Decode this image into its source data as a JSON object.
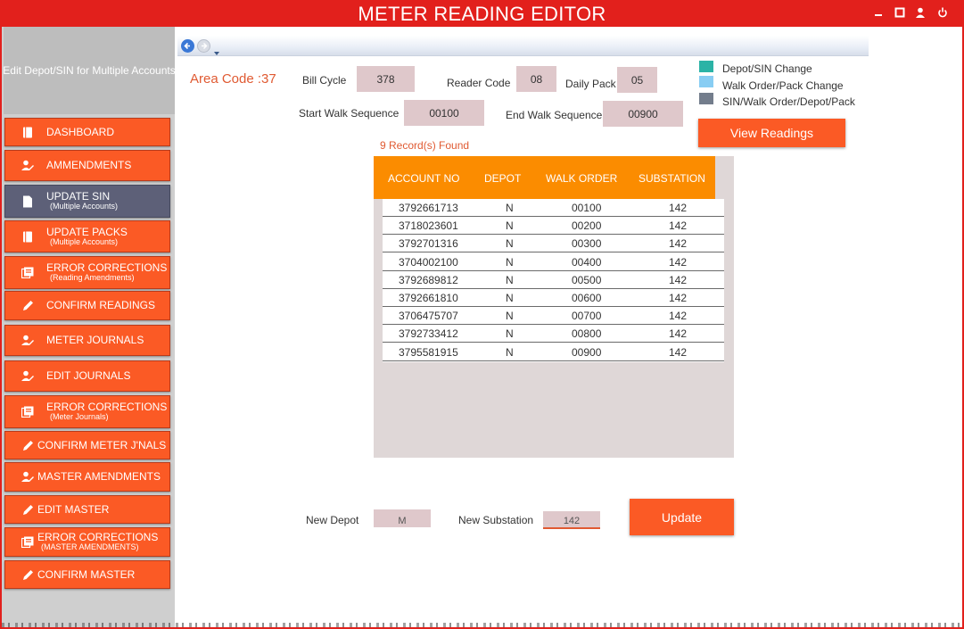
{
  "window": {
    "title": "METER READING EDITOR",
    "controls": [
      "minimize-icon",
      "maximize-icon",
      "user-icon",
      "power-icon"
    ]
  },
  "sidebar": {
    "header": "Edit Depot/SIN for Multiple Accounts",
    "items": [
      {
        "label": "DASHBOARD",
        "sub": "",
        "icon": "book-icon",
        "active": false
      },
      {
        "label": "AMMENDMENTS",
        "sub": "",
        "icon": "user-edit-icon",
        "active": false
      },
      {
        "label": "UPDATE SIN",
        "sub": "(Multiple Accounts)",
        "icon": "document-icon",
        "active": true
      },
      {
        "label": "UPDATE PACKS",
        "sub": "(Multiple Accounts)",
        "icon": "book-icon",
        "active": false
      },
      {
        "label": "ERROR CORRECTIONS",
        "sub": "(Reading Amendments)",
        "icon": "list-icon",
        "active": false
      },
      {
        "label": "CONFIRM READINGS",
        "sub": "",
        "icon": "pencil-icon",
        "active": false
      },
      {
        "label": "METER JOURNALS",
        "sub": "",
        "icon": "user-edit-icon",
        "active": false
      },
      {
        "label": "EDIT JOURNALS",
        "sub": "",
        "icon": "user-edit-icon",
        "active": false
      },
      {
        "label": "ERROR CORRECTIONS",
        "sub": "(Meter Journals)",
        "icon": "list-icon",
        "active": false
      },
      {
        "label": "CONFIRM METER J'NALS",
        "sub": "",
        "icon": "pencil-icon",
        "active": false
      },
      {
        "label": "MASTER AMENDMENTS",
        "sub": "",
        "icon": "user-edit-icon",
        "active": false
      },
      {
        "label": "EDIT MASTER",
        "sub": "",
        "icon": "pencil-icon",
        "active": false
      },
      {
        "label": "ERROR CORRECTIONS",
        "sub": "(MASTER AMENDMENTS)",
        "icon": "list-icon",
        "active": false
      },
      {
        "label": "CONFIRM MASTER",
        "sub": "",
        "icon": "pencil-icon",
        "active": false
      }
    ]
  },
  "filters": {
    "area_code": "Area Code :37",
    "bill_cycle_label": "Bill Cycle",
    "bill_cycle": "378",
    "reader_code_label": "Reader Code",
    "reader_code": "08",
    "daily_pack_label": "Daily Pack",
    "daily_pack": "05",
    "start_walk_label": "Start Walk Sequence",
    "start_walk": "00100",
    "end_walk_label": "End Walk Sequence",
    "end_walk": "00900"
  },
  "legend": [
    {
      "label": "Depot/SIN Change",
      "color": "#2bb3a6"
    },
    {
      "label": "Walk Order/Pack Change",
      "color": "#88cdf3"
    },
    {
      "label": "SIN/Walk Order/Depot/Pack",
      "color": "#737d8c"
    }
  ],
  "view_button": "View Readings",
  "records_found": "9 Record(s) Found",
  "grid": {
    "columns": [
      "ACCOUNT NO",
      "DEPOT",
      "WALK ORDER",
      "SUBSTATION"
    ],
    "rows": [
      [
        "3792661713",
        "N",
        "00100",
        "142"
      ],
      [
        "3718023601",
        "N",
        "00200",
        "142"
      ],
      [
        "3792701316",
        "N",
        "00300",
        "142"
      ],
      [
        "3704002100",
        "N",
        "00400",
        "142"
      ],
      [
        "3792689812",
        "N",
        "00500",
        "142"
      ],
      [
        "3792661810",
        "N",
        "00600",
        "142"
      ],
      [
        "3706475707",
        "N",
        "00700",
        "142"
      ],
      [
        "3792733412",
        "N",
        "00800",
        "142"
      ],
      [
        "3795581915",
        "N",
        "00900",
        "142"
      ]
    ]
  },
  "update_form": {
    "new_depot_label": "New Depot",
    "new_depot": "M",
    "new_substation_label": "New Substation",
    "new_substation": "142",
    "update_button": "Update"
  }
}
